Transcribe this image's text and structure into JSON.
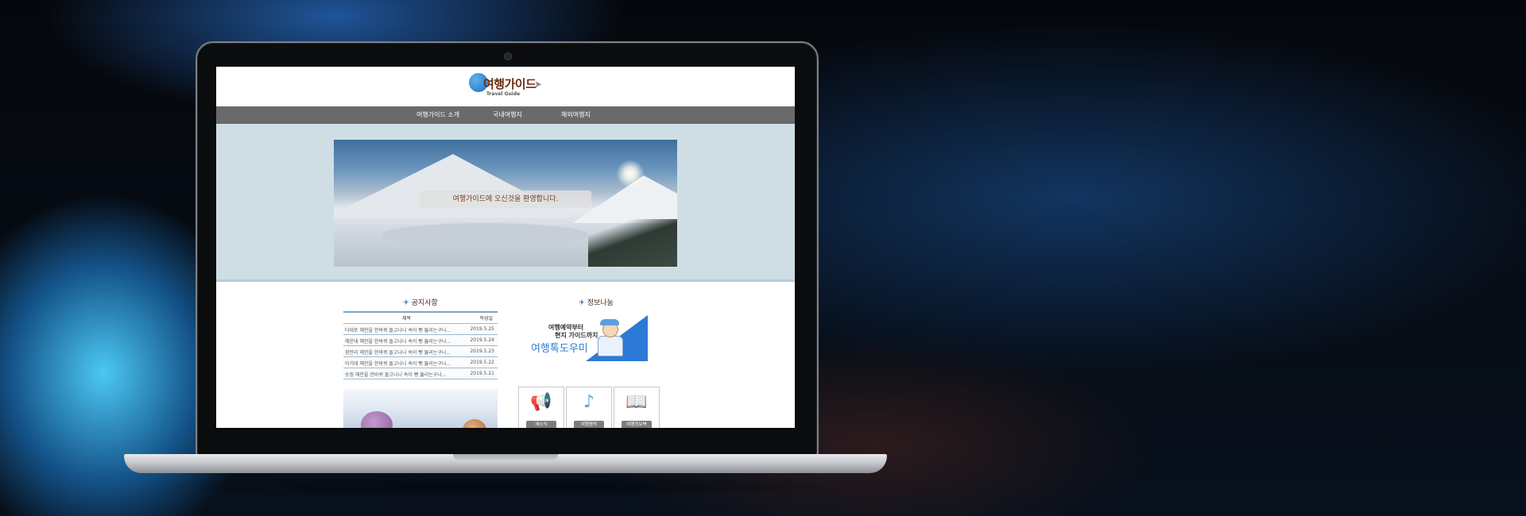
{
  "site": {
    "logo_title": "여행가이드",
    "logo_subtitle": "Travel Guide",
    "nav": [
      {
        "label": "여행가이드 소개"
      },
      {
        "label": "국내여행지"
      },
      {
        "label": "해외여행지"
      }
    ],
    "hero_caption": "여행가이드에 오신것을 환영합니다."
  },
  "notice": {
    "title": "공지사항",
    "columns": {
      "title": "제목",
      "date": "작성일"
    },
    "rows": [
      {
        "title": "다대포 해안을 한바퀴 돌고나니 속이 뻥 뚫리는구나...",
        "date": "2019.5.25"
      },
      {
        "title": "해운대 해안을 한바퀴 돌고나니 속이 뻥 뚫리는구나...",
        "date": "2019.5.24"
      },
      {
        "title": "광안리 해안을 한바퀴 돌고나니 속이 뻥 뚫리는구나...",
        "date": "2019.5.23"
      },
      {
        "title": "이기대 해안을 한바퀴 돌고나니 속이 뻥 뚫리는구나...",
        "date": "2019.5.22"
      },
      {
        "title": "송정 해안을 한바퀴 돌고나니 속이 뻥 뚫리는구나...",
        "date": "2019.5.21"
      }
    ]
  },
  "info": {
    "title": "정보나눔",
    "ad_line1": "여행예약부터",
    "ad_line2": "현지 가이드까지",
    "ad_line3": "여행톡도우미",
    "tiles": [
      {
        "label": "새소식",
        "icon": "megaphone-icon"
      },
      {
        "label": "여행음악",
        "icon": "music-note-icon"
      },
      {
        "label": "여행정보북",
        "icon": "book-icon"
      }
    ]
  }
}
